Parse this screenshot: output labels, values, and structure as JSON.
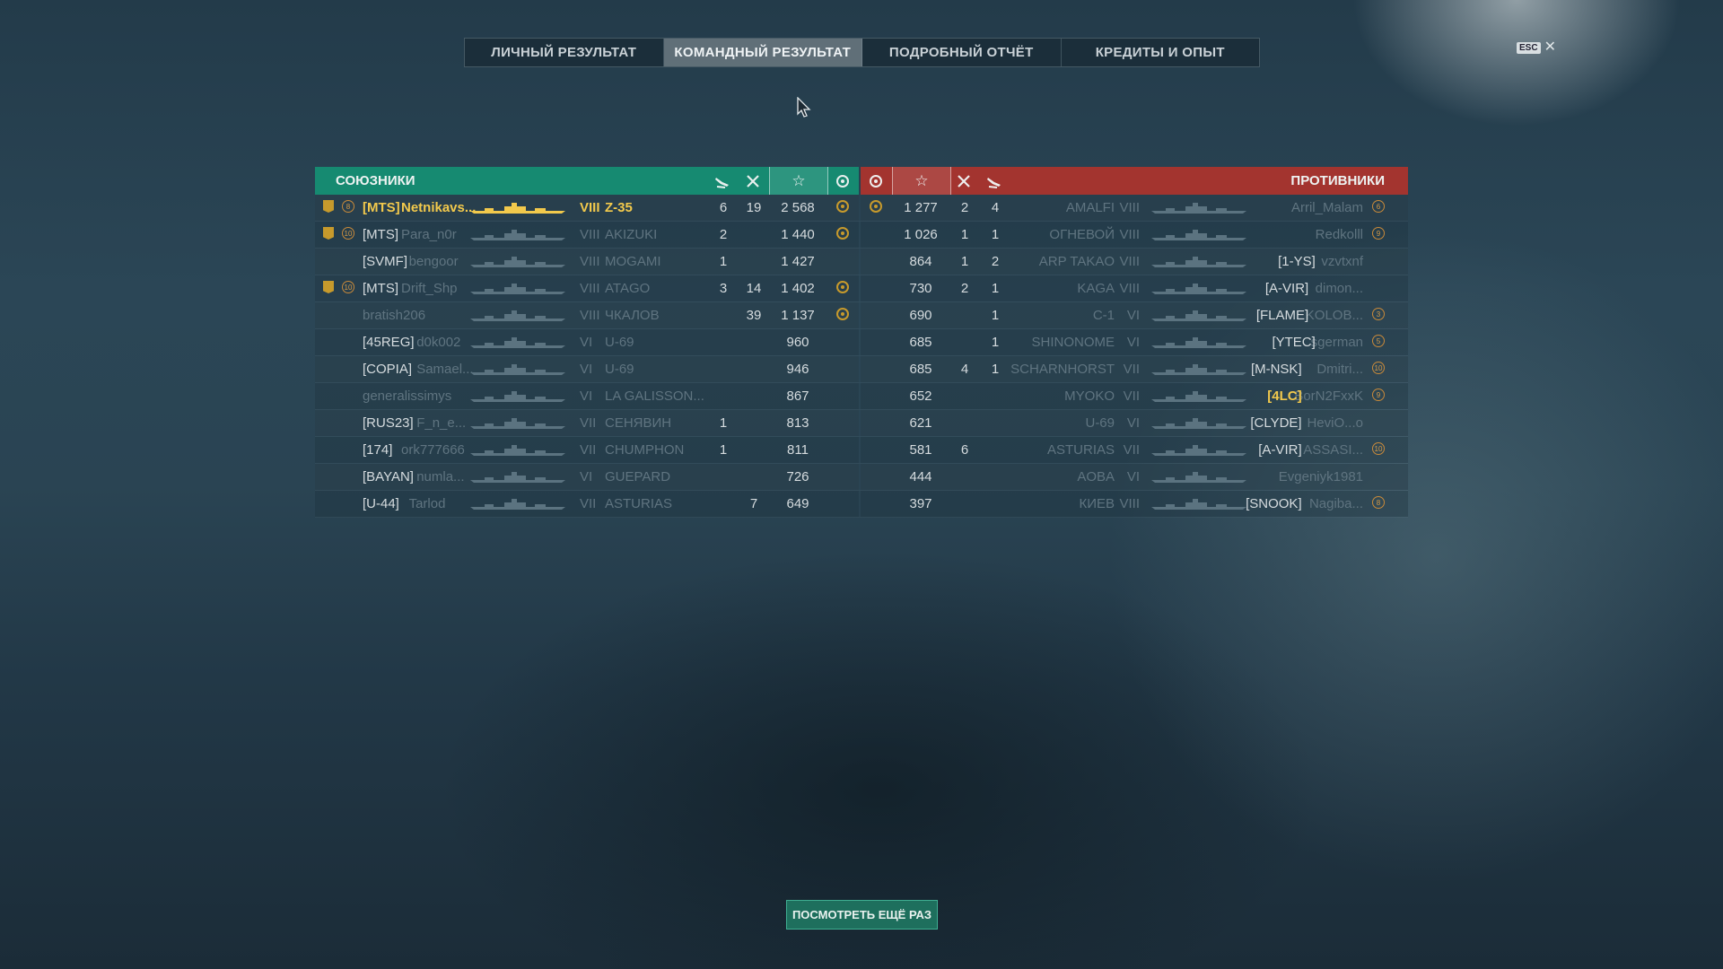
{
  "tabs": [
    "ЛИЧНЫЙ РЕЗУЛЬТАТ",
    "КОМАНДНЫЙ РЕЗУЛЬТАТ",
    "ПОДРОБНЫЙ ОТЧЁТ",
    "КРЕДИТЫ И ОПЫТ"
  ],
  "active_tab": "КОМАНДНЫЙ РЕЗУЛЬТАТ",
  "esc_label": "ESC",
  "close_glyph": "✕",
  "allies_title": "СОЮЗНИКИ",
  "enemies_title": "ПРОТИВНИКИ",
  "star_glyph": "☆",
  "replay_button": "ПОСМОТРЕТЬ ЕЩЁ РАЗ",
  "allies": [
    {
      "badge": true,
      "level": "8",
      "clan": "[MTS]",
      "name": "Netnikavs...",
      "tier": "VIII",
      "ship": "Z-35",
      "planes": "6",
      "frags": "19",
      "xp": "2 568",
      "medal": true,
      "highlight": true
    },
    {
      "badge": true,
      "level": "10",
      "clan": "[MTS]",
      "name": "Para_n0r",
      "tier": "VIII",
      "ship": "AKIZUKI",
      "planes": "2",
      "frags": "",
      "xp": "1 440",
      "medal": true
    },
    {
      "badge": false,
      "level": "",
      "clan": "[SVMF]",
      "name": "bengoor",
      "tier": "VIII",
      "ship": "MOGAMI",
      "planes": "1",
      "frags": "",
      "xp": "1 427",
      "medal": false
    },
    {
      "badge": true,
      "level": "10",
      "clan": "[MTS]",
      "name": "Drift_Shp",
      "tier": "VIII",
      "ship": "ATAGO",
      "planes": "3",
      "frags": "14",
      "xp": "1 402",
      "medal": true
    },
    {
      "badge": false,
      "level": "",
      "clan": "",
      "name": "bratish206",
      "tier": "VIII",
      "ship": "ЧКАЛОВ",
      "planes": "",
      "frags": "39",
      "xp": "1 137",
      "medal": true
    },
    {
      "badge": false,
      "level": "",
      "clan": "[45REG]",
      "name": "d0k002",
      "tier": "VI",
      "ship": "U-69",
      "planes": "",
      "frags": "",
      "xp": "960",
      "medal": false
    },
    {
      "badge": false,
      "level": "",
      "clan": "[COPIA]",
      "name": "Samael...",
      "tier": "VI",
      "ship": "U-69",
      "planes": "",
      "frags": "",
      "xp": "946",
      "medal": false
    },
    {
      "badge": false,
      "level": "",
      "clan": "",
      "name": "generalissimys",
      "tier": "VI",
      "ship": "LA GALISSON...",
      "planes": "",
      "frags": "",
      "xp": "867",
      "medal": false
    },
    {
      "badge": false,
      "level": "",
      "clan": "[RUS23]",
      "name": "F_n_e...",
      "tier": "VII",
      "ship": "СЕНЯВИН",
      "planes": "1",
      "frags": "",
      "xp": "813",
      "medal": false
    },
    {
      "badge": false,
      "level": "",
      "clan": "[174]",
      "name": "ork777666",
      "tier": "VII",
      "ship": "CHUMPHON",
      "planes": "1",
      "frags": "",
      "xp": "811",
      "medal": false
    },
    {
      "badge": false,
      "level": "",
      "clan": "[BAYAN]",
      "name": "numla...",
      "tier": "VI",
      "ship": "GUEPARD",
      "planes": "",
      "frags": "",
      "xp": "726",
      "medal": false
    },
    {
      "badge": false,
      "level": "",
      "clan": "[U-44]",
      "name": "Tarlod",
      "tier": "VII",
      "ship": "ASTURIAS",
      "planes": "",
      "frags": "7",
      "xp": "649",
      "medal": false
    }
  ],
  "enemies": [
    {
      "medal": true,
      "xp": "1 277",
      "frags": "2",
      "planes": "4",
      "ship": "AMALFI",
      "tier": "VIII",
      "clan": "",
      "name": "Arril_Malam",
      "level": "6"
    },
    {
      "medal": false,
      "xp": "1 026",
      "frags": "1",
      "planes": "1",
      "ship": "ОГНЕВОЙ",
      "tier": "VIII",
      "clan": "",
      "name": "Redkolll",
      "level": "9"
    },
    {
      "medal": false,
      "xp": "864",
      "frags": "1",
      "planes": "2",
      "ship": "ARP TAKAO",
      "tier": "VIII",
      "clan": "[1-YS]",
      "name": "vzvtxnf",
      "level": ""
    },
    {
      "medal": false,
      "xp": "730",
      "frags": "2",
      "planes": "1",
      "ship": "KAGA",
      "tier": "VIII",
      "clan": "[A-VIR]",
      "name": "dimon...",
      "level": ""
    },
    {
      "medal": false,
      "xp": "690",
      "frags": "",
      "planes": "1",
      "ship": "C-1",
      "tier": "VI",
      "clan": "[FLAME]",
      "name": "KOLOB...",
      "level": "3"
    },
    {
      "medal": false,
      "xp": "685",
      "frags": "",
      "planes": "1",
      "ship": "SHINONOME",
      "tier": "VI",
      "clan": "[YTEC]",
      "name": "sgerman",
      "level": "5"
    },
    {
      "medal": false,
      "xp": "685",
      "frags": "4",
      "planes": "1",
      "ship": "SCHARNHORST",
      "tier": "VII",
      "clan": "[M-NSK]",
      "name": "Dmitri...",
      "level": "10"
    },
    {
      "medal": false,
      "xp": "652",
      "frags": "",
      "planes": "",
      "ship": "MYOKO",
      "tier": "VII",
      "clan": "[4LC]",
      "name": "BorN2FxxK",
      "level": "9"
    },
    {
      "medal": false,
      "xp": "621",
      "frags": "",
      "planes": "",
      "ship": "U-69",
      "tier": "VI",
      "clan": "[CLYDE]",
      "name": "HeviO...o",
      "level": ""
    },
    {
      "medal": false,
      "xp": "581",
      "frags": "6",
      "planes": "",
      "ship": "ASTURIAS",
      "tier": "VII",
      "clan": "[A-VIR]",
      "name": "ASSASI...",
      "level": "10"
    },
    {
      "medal": false,
      "xp": "444",
      "frags": "",
      "planes": "",
      "ship": "AOBA",
      "tier": "VI",
      "clan": "",
      "name": "Evgeniyk1981",
      "level": ""
    },
    {
      "medal": false,
      "xp": "397",
      "frags": "",
      "planes": "",
      "ship": "КИЕВ",
      "tier": "VIII",
      "clan": "[SNOOK]",
      "name": "Nagiba...",
      "level": "8"
    }
  ]
}
